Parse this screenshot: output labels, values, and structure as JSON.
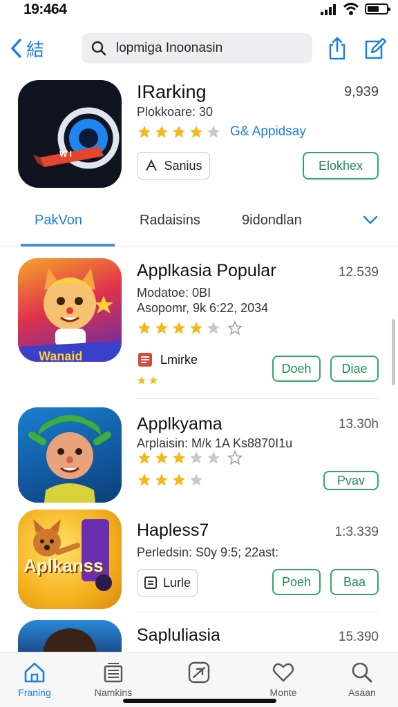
{
  "status": {
    "time": "19:464"
  },
  "nav": {
    "back_label": "結",
    "search_text": "lopmiga Inoonasin"
  },
  "featured": {
    "title": "IRarking",
    "count": "9,939",
    "subtitle": "Plokkoare: 30",
    "rating_stars": 4,
    "tag": "G& Appidsay",
    "secondary_button": "Sanius",
    "primary_button": "Elokhex",
    "icon_ribbon_text": "W I"
  },
  "tabs": [
    "PakVon",
    "Radaisins",
    "9idondlan"
  ],
  "apps": [
    {
      "title": "Applkasia Popular",
      "count": "12.539",
      "lines": [
        "Modatoe: 0BI",
        "Asopomr, 9k 6:22, 2034"
      ],
      "stars_row1": 4,
      "stars_row2": 2,
      "chip_label": "Lmirke",
      "buttons": [
        "Doeh",
        "Diae"
      ],
      "icon_text": "Wanaid"
    },
    {
      "title": "Applkyama",
      "count": "13.30h",
      "lines": [
        "Arplaisin: M/k 1A Ks8870I1u"
      ],
      "stars_row1": 3,
      "stars_row2": 3,
      "buttons": [
        "Pvav"
      ]
    },
    {
      "title": "Hapless7",
      "count": "1:3.339",
      "lines": [
        "Perledsin: S0y 9:5; 22ast:"
      ],
      "chip_label": "Lurle",
      "buttons": [
        "Poeh",
        "Baa"
      ],
      "icon_text": "Aplkanss"
    },
    {
      "title": "Sapluliasia",
      "count": "15.390"
    }
  ],
  "tabbar": [
    "Franing",
    "Namkins",
    "",
    "Monte",
    "Asaan"
  ],
  "colors": {
    "accent": "#1b7fe0",
    "green": "#2ea86a",
    "star": "#f5b81c",
    "star_off": "#c9c9cc"
  }
}
